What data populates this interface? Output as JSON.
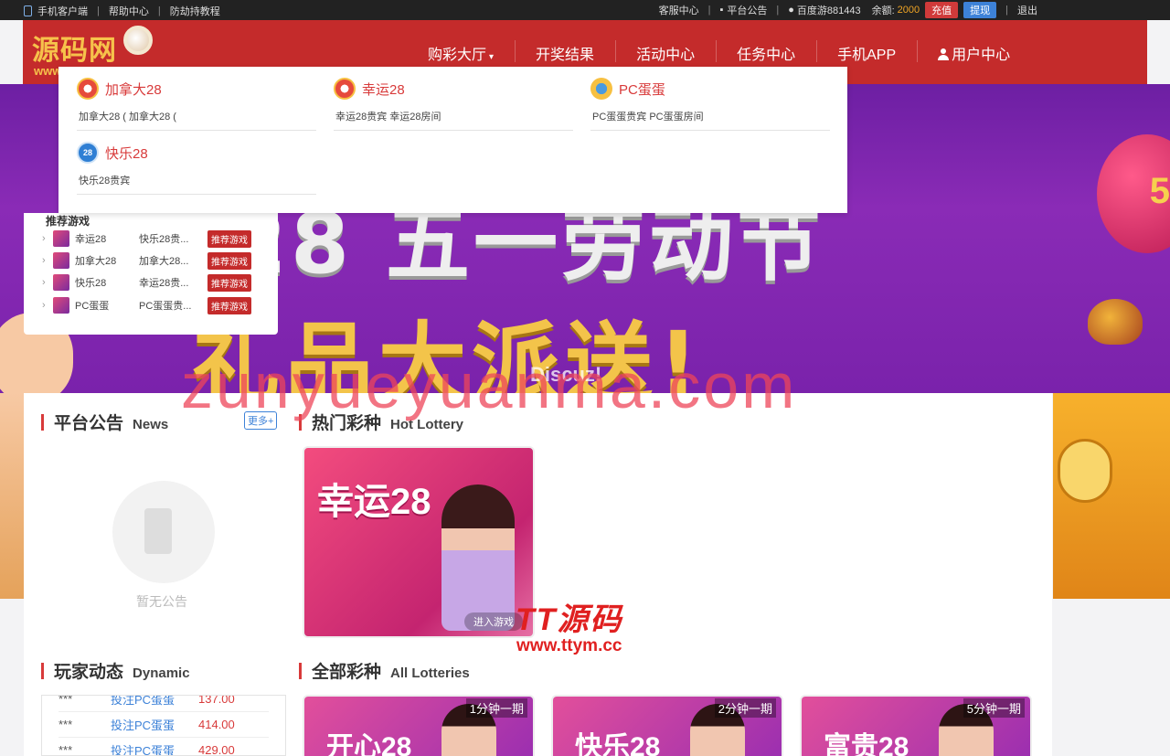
{
  "topbar": {
    "mobile_client": "手机客户端",
    "help_center": "帮助中心",
    "anti_hijack": "防劫持教程",
    "customer_service": "客服中心",
    "announcement": "平台公告",
    "username": "百度游881443",
    "balance_label": "余额:",
    "balance_value": "2000",
    "recharge": "充值",
    "withdraw": "提现",
    "logout": "退出"
  },
  "header": {
    "logo_text": "源码网",
    "logo_sub": "www",
    "nav": [
      "购彩大厅",
      "开奖结果",
      "活动中心",
      "任务中心",
      "手机APP",
      "用户中心"
    ]
  },
  "dropdown": {
    "items": [
      {
        "name": "加拿大28",
        "sub": "加拿大28 ( 加拿大28 ( ",
        "icon": "canada28-icon"
      },
      {
        "name": "幸运28",
        "sub": "幸运28贵宾 幸运28房间",
        "icon": "lucky28-icon"
      },
      {
        "name": "PC蛋蛋",
        "sub": "PC蛋蛋贵宾 PC蛋蛋房间",
        "icon": "pcegg-icon"
      },
      {
        "name": "快乐28",
        "sub": "快乐28贵宾",
        "icon": "happy28-icon"
      }
    ]
  },
  "recommend": {
    "title": "推荐游戏",
    "tag": "推荐游戏",
    "rows": [
      {
        "name": "幸运28",
        "desc": "快乐28贵..."
      },
      {
        "name": "加拿大28",
        "desc": "加拿大28..."
      },
      {
        "name": "快乐28",
        "desc": "幸运28贵..."
      },
      {
        "name": "PC蛋蛋",
        "desc": "PC蛋蛋贵..."
      }
    ]
  },
  "banner": {
    "line1": "28 五一劳动节",
    "line2": "礼品大派送!",
    "balloon": "5",
    "discuz": "Discuz!"
  },
  "watermark": "zunyueyuanma.com",
  "notice": {
    "title_cn": "平台公告",
    "title_en": "News",
    "more": "更多+",
    "empty": "暂无公告"
  },
  "hot": {
    "title_cn": "热门彩种",
    "title_en": "Hot Lottery",
    "card_name": "幸运28",
    "enter": "进入游戏"
  },
  "dynamic": {
    "title_cn": "玩家动态",
    "title_en": "Dynamic",
    "rows": [
      {
        "user": "***",
        "action": "投注PC蛋蛋",
        "amount": "137.00"
      },
      {
        "user": "***",
        "action": "投注PC蛋蛋",
        "amount": "414.00"
      },
      {
        "user": "***",
        "action": "投注PC蛋蛋",
        "amount": "429.00"
      }
    ]
  },
  "all": {
    "title_cn": "全部彩种",
    "title_en": "All Lotteries",
    "cards": [
      {
        "name": "开心28",
        "period": "1分钟一期"
      },
      {
        "name": "快乐28",
        "period": "2分钟一期"
      },
      {
        "name": "富贵28",
        "period": "5分钟一期"
      }
    ]
  },
  "ttym": {
    "brand": "TT源码",
    "url": "www.ttym.cc"
  }
}
